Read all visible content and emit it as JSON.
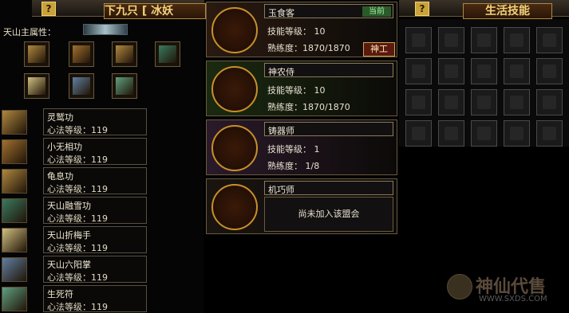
{
  "top_left": {
    "help": "?",
    "title": "下九只 [ 冰妖"
  },
  "top_right": {
    "help": "?",
    "title": "生活技能"
  },
  "attributes": {
    "label": "天山主属性："
  },
  "book_slots": [
    {
      "icon": "scroll-book-icon",
      "color": "#b08840"
    },
    {
      "icon": "scroll-book-icon",
      "color": "#a07030"
    },
    {
      "icon": "scroll-book-icon",
      "color": "#b08840"
    },
    {
      "icon": "green-book-icon",
      "color": "#3a7a60"
    },
    {
      "icon": "paper-talisman-icon",
      "color": "#d0c080"
    },
    {
      "icon": "blue-book-icon",
      "color": "#6080a0"
    },
    {
      "icon": "green-talisman-icon",
      "color": "#60a080"
    }
  ],
  "skills": [
    {
      "name": "灵鹫功",
      "level": "心法等级：119",
      "color": "#b08840"
    },
    {
      "name": "小无相功",
      "level": "心法等级：119",
      "color": "#a07030"
    },
    {
      "name": "龟息功",
      "level": "心法等级：119",
      "color": "#b08840"
    },
    {
      "name": "天山融雪功",
      "level": "心法等级：119",
      "color": "#3a7a60"
    },
    {
      "name": "天山折梅手",
      "level": "心法等级：119",
      "color": "#d0c080"
    },
    {
      "name": "天山六阳掌",
      "level": "心法等级：119",
      "color": "#6080a0"
    },
    {
      "name": "生死符",
      "level": "心法等级：119",
      "color": "#60a080"
    }
  ],
  "professions": [
    {
      "name": "玉食客",
      "current": "当前",
      "skill_level": "技能等级：     10",
      "proficiency": "熟练度：1870/1870",
      "action": "神工",
      "bg": "#2a1a10",
      "emblem": "dragon-emblem-icon"
    },
    {
      "name": "神农侍",
      "skill_level": "技能等级：     10",
      "proficiency": "熟练度：1870/1870",
      "bg": "#1a2a10",
      "emblem": "yin-yang-emblem-icon"
    },
    {
      "name": "铸器师",
      "skill_level": "技能等级：      1",
      "proficiency": "熟练度：    1/8",
      "bg": "#2a1a2a",
      "emblem": "forge-emblem-icon"
    },
    {
      "name": "机巧师",
      "status": "尚未加入该盟会",
      "bg": "#1a1410",
      "emblem": "mechanism-emblem-icon"
    }
  ],
  "watermark": {
    "brand": "神仙代售",
    "url": "WWW.SXDS.COM"
  }
}
